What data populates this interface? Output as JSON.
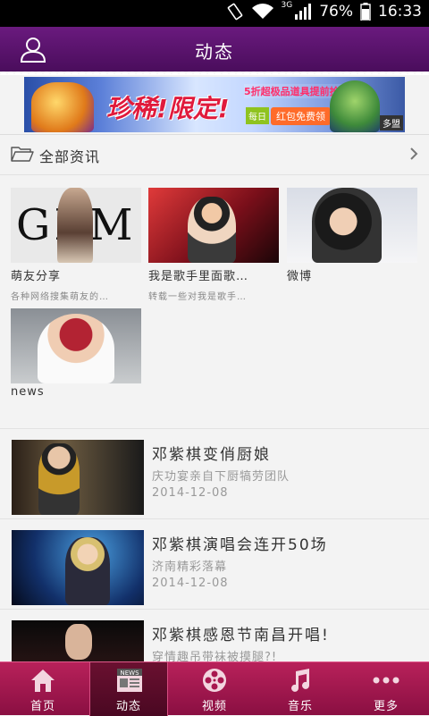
{
  "status_bar": {
    "network": "3G",
    "battery": "76%",
    "time": "16:33"
  },
  "header": {
    "title": "动态"
  },
  "banner": {
    "headline": "珍稀!限定!",
    "promo": "5折超极品道具提前抢购",
    "tag": "每日",
    "button": "红包免费领",
    "corner": "多盟"
  },
  "section": {
    "label": "全部资讯"
  },
  "grid": [
    {
      "name": "萌友分享",
      "desc": "各种网络搜集萌友的…"
    },
    {
      "name": "我是歌手里面歌…",
      "desc": "转载一些对我是歌手…"
    },
    {
      "name": "微博",
      "desc": ""
    },
    {
      "name": "news",
      "desc": ""
    }
  ],
  "gem_text": "GEM",
  "news": [
    {
      "title": "邓紫棋变俏厨娘",
      "subtitle": "庆功宴亲自下厨犒劳团队",
      "date": "2014-12-08"
    },
    {
      "title": "邓紫棋演唱会连开50场",
      "subtitle": "济南精彩落幕",
      "date": "2014-12-08"
    },
    {
      "title": "邓紫棋感恩节南昌开唱!",
      "subtitle": "穿情趣吊带袜被摸腿?!",
      "date": ""
    }
  ],
  "tabs": [
    {
      "label": "首页",
      "icon": "home-icon",
      "active": false
    },
    {
      "label": "动态",
      "icon": "news-icon",
      "active": true
    },
    {
      "label": "视频",
      "icon": "film-reel-icon",
      "active": false
    },
    {
      "label": "音乐",
      "icon": "music-note-icon",
      "active": false
    },
    {
      "label": "更多",
      "icon": "more-dots-icon",
      "active": false
    }
  ],
  "news_icon_text": "NEWS",
  "colors": {
    "header": "#5a1270",
    "tabbar": "#a8184f",
    "tab_active": "#5a0c2a"
  }
}
